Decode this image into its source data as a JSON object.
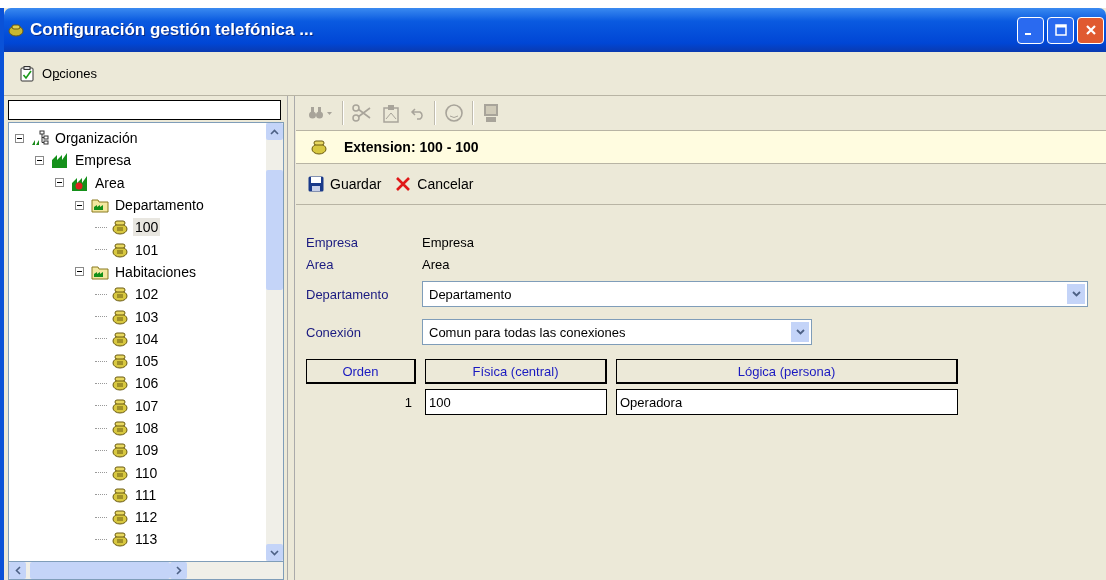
{
  "window": {
    "title": "Configuración gestión telefónica ..."
  },
  "menu": [
    {
      "label": "Opciones"
    }
  ],
  "sidebar": {
    "tree": [
      {
        "label": "Organización",
        "kind": "org",
        "expanded": true,
        "selected": false,
        "children": [
          {
            "label": "Empresa",
            "kind": "company",
            "expanded": true,
            "selected": false,
            "children": [
              {
                "label": "Area",
                "kind": "area",
                "expanded": true,
                "selected": false,
                "children": [
                  {
                    "label": "Departamento",
                    "kind": "folder",
                    "expanded": true,
                    "selected": false,
                    "children": [
                      {
                        "label": "100",
                        "kind": "phone",
                        "selected": true
                      },
                      {
                        "label": "101",
                        "kind": "phone",
                        "selected": false
                      }
                    ]
                  },
                  {
                    "label": "Habitaciones",
                    "kind": "folder",
                    "expanded": true,
                    "selected": false,
                    "children": [
                      {
                        "label": "102",
                        "kind": "phone",
                        "selected": false
                      },
                      {
                        "label": "103",
                        "kind": "phone",
                        "selected": false
                      },
                      {
                        "label": "104",
                        "kind": "phone",
                        "selected": false
                      },
                      {
                        "label": "105",
                        "kind": "phone",
                        "selected": false
                      },
                      {
                        "label": "106",
                        "kind": "phone",
                        "selected": false
                      },
                      {
                        "label": "107",
                        "kind": "phone",
                        "selected": false
                      },
                      {
                        "label": "108",
                        "kind": "phone",
                        "selected": false
                      },
                      {
                        "label": "109",
                        "kind": "phone",
                        "selected": false
                      },
                      {
                        "label": "110",
                        "kind": "phone",
                        "selected": false
                      },
                      {
                        "label": "111",
                        "kind": "phone",
                        "selected": false
                      },
                      {
                        "label": "112",
                        "kind": "phone",
                        "selected": false
                      },
                      {
                        "label": "113",
                        "kind": "phone",
                        "selected": false
                      }
                    ]
                  }
                ]
              }
            ]
          }
        ]
      }
    ]
  },
  "toolbar": [
    {
      "kind": "find",
      "disabled": true
    },
    {
      "kind": "sep"
    },
    {
      "kind": "cut",
      "disabled": true
    },
    {
      "kind": "paste",
      "disabled": true
    },
    {
      "kind": "undo",
      "disabled": true
    },
    {
      "kind": "sep"
    },
    {
      "kind": "face",
      "disabled": true
    },
    {
      "kind": "sep"
    },
    {
      "kind": "computer",
      "disabled": true
    }
  ],
  "header": {
    "title": "Extension: 100 - 100"
  },
  "actions": [
    {
      "label": "Guardar",
      "kind": "save"
    },
    {
      "label": "Cancelar",
      "kind": "cancel"
    }
  ],
  "form": [
    {
      "label": "Empresa",
      "kind": "static",
      "value": "Empresa"
    },
    {
      "label": "Area",
      "kind": "static",
      "value": "Area"
    },
    {
      "label": "Departamento",
      "kind": "dropdown",
      "value": "Departamento",
      "wide": true
    },
    {
      "label": "Conexión",
      "kind": "dropdown",
      "value": "Comun para todas las conexiones",
      "wide": false
    }
  ],
  "table": {
    "columns": [
      "Orden",
      "Física (central)",
      "Lógica (persona)"
    ],
    "rows": [
      [
        "1",
        "100",
        "Operadora"
      ]
    ]
  }
}
